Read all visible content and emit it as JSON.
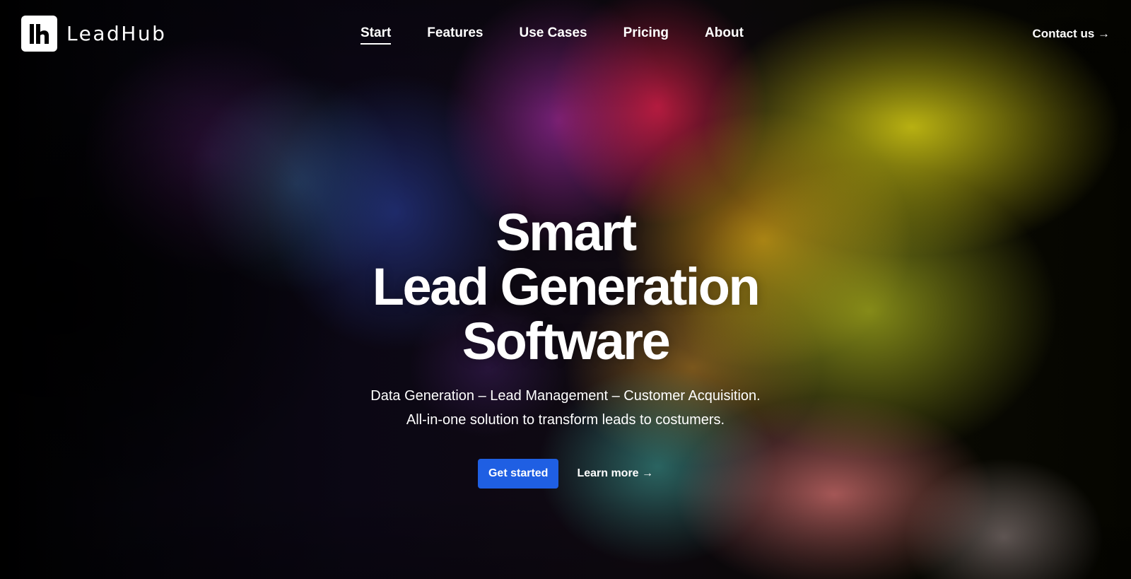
{
  "brand": {
    "name": "LeadHub",
    "logo_icon": "lh-monogram-icon"
  },
  "nav": {
    "items": [
      {
        "label": "Start",
        "active": true
      },
      {
        "label": "Features",
        "active": false
      },
      {
        "label": "Use Cases",
        "active": false
      },
      {
        "label": "Pricing",
        "active": false
      },
      {
        "label": "About",
        "active": false
      }
    ],
    "contact_label": "Contact us →"
  },
  "hero": {
    "title_lines": [
      "Smart",
      "Lead Generation",
      "Software"
    ],
    "subtitle_lines": [
      "Data Generation – Lead Management – Customer Acquisition.",
      "All-in-one solution to transform leads to costumers."
    ],
    "primary_cta": "Get started",
    "secondary_cta": "Learn more →"
  },
  "colors": {
    "primary_button": "#1f5fe3",
    "text": "#ffffff",
    "background": "#000000"
  }
}
